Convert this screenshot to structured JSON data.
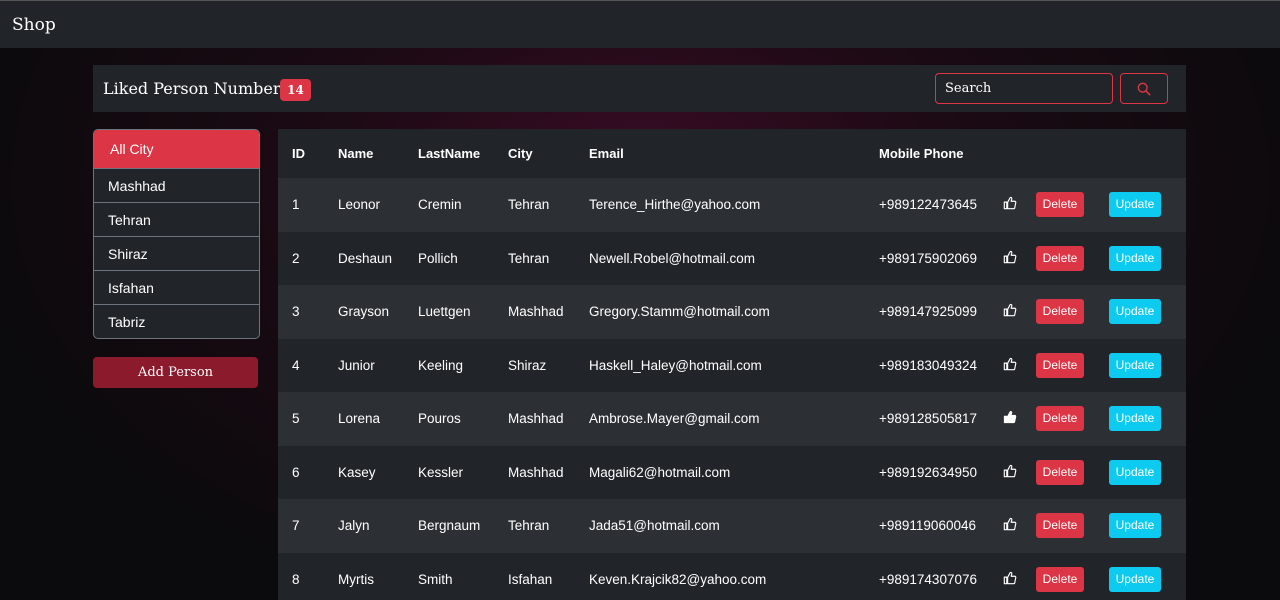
{
  "navbar": {
    "brand": "Shop"
  },
  "header": {
    "liked_label": "Liked Person Number :",
    "liked_count": "14",
    "search_placeholder": "Search"
  },
  "sidebar": {
    "cities": [
      "All City",
      "Mashhad",
      "Tehran",
      "Shiraz",
      "Isfahan",
      "Tabriz"
    ],
    "add_button": "Add Person"
  },
  "table": {
    "columns": [
      "ID",
      "Name",
      "LastName",
      "City",
      "Email",
      "Mobile Phone"
    ],
    "delete_label": "Delete",
    "update_label": "Update",
    "rows": [
      {
        "id": "1",
        "name": "Leonor",
        "last": "Cremin",
        "city": "Tehran",
        "email": "Terence_Hirthe@yahoo.com",
        "phone": "+989122473645",
        "liked": false
      },
      {
        "id": "2",
        "name": "Deshaun",
        "last": "Pollich",
        "city": "Tehran",
        "email": "Newell.Robel@hotmail.com",
        "phone": "+989175902069",
        "liked": false
      },
      {
        "id": "3",
        "name": "Grayson",
        "last": "Luettgen",
        "city": "Mashhad",
        "email": "Gregory.Stamm@hotmail.com",
        "phone": "+989147925099",
        "liked": false
      },
      {
        "id": "4",
        "name": "Junior",
        "last": "Keeling",
        "city": "Shiraz",
        "email": "Haskell_Haley@hotmail.com",
        "phone": "+989183049324",
        "liked": false
      },
      {
        "id": "5",
        "name": "Lorena",
        "last": "Pouros",
        "city": "Mashhad",
        "email": "Ambrose.Mayer@gmail.com",
        "phone": "+989128505817",
        "liked": true
      },
      {
        "id": "6",
        "name": "Kasey",
        "last": "Kessler",
        "city": "Mashhad",
        "email": "Magali62@hotmail.com",
        "phone": "+989192634950",
        "liked": false
      },
      {
        "id": "7",
        "name": "Jalyn",
        "last": "Bergnaum",
        "city": "Tehran",
        "email": "Jada51@hotmail.com",
        "phone": "+989119060046",
        "liked": false
      },
      {
        "id": "8",
        "name": "Myrtis",
        "last": "Smith",
        "city": "Isfahan",
        "email": "Keven.Krajcik82@yahoo.com",
        "phone": "+989174307076",
        "liked": false
      }
    ]
  },
  "colors": {
    "danger": "#dc3545",
    "info": "#0dcaf0",
    "dark": "#212529"
  }
}
